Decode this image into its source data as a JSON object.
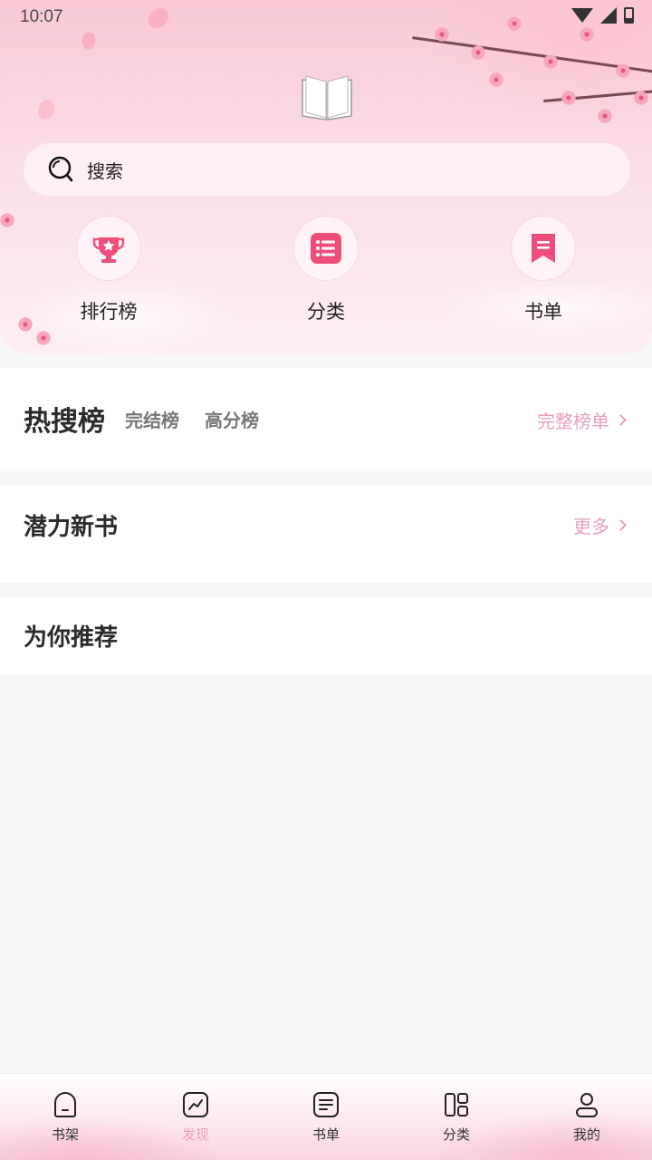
{
  "status_bar": {
    "time": "10:07"
  },
  "search": {
    "placeholder": "搜索"
  },
  "quick_actions": [
    {
      "label": "排行榜",
      "icon": "trophy-icon"
    },
    {
      "label": "分类",
      "icon": "category-list-icon"
    },
    {
      "label": "书单",
      "icon": "bookmark-icon"
    }
  ],
  "hot_section": {
    "title": "热搜榜",
    "tabs": [
      "完结榜",
      "高分榜"
    ],
    "more": "完整榜单"
  },
  "new_books_section": {
    "title": "潜力新书",
    "more": "更多"
  },
  "recommend_section": {
    "title": "为你推荐"
  },
  "bottom_nav": {
    "items": [
      {
        "label": "书架",
        "icon": "bookshelf-icon"
      },
      {
        "label": "发现",
        "icon": "discover-chart-icon",
        "active": true
      },
      {
        "label": "书单",
        "icon": "booklist-icon"
      },
      {
        "label": "分类",
        "icon": "category-grid-icon"
      },
      {
        "label": "我的",
        "icon": "profile-icon"
      }
    ]
  },
  "colors": {
    "accent": "#e9a0b6",
    "icon_pink": "#ee4f7a",
    "background": "#f7f7f7"
  }
}
